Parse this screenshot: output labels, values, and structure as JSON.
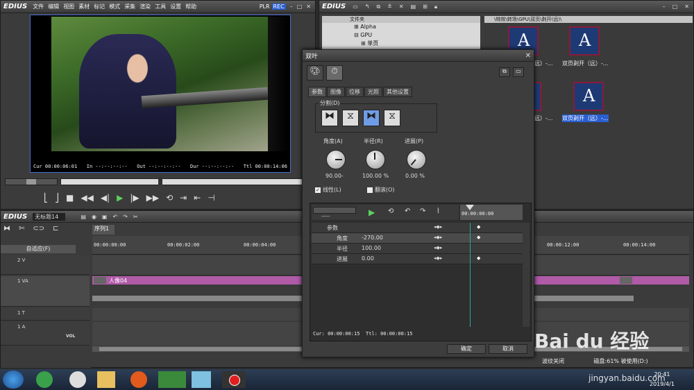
{
  "player": {
    "logo": "EDIUS",
    "menu": [
      "文件",
      "编辑",
      "视图",
      "素材",
      "标记",
      "模式",
      "采集",
      "渲染",
      "工具",
      "设置",
      "帮助"
    ],
    "plr": "PLR",
    "rec": "REC",
    "cur": "Cur 00:00:06:01",
    "in": "In --:--:--:--",
    "out": "Out --:--:--:--",
    "dur": "Dur --:--:--:--",
    "ttl": "Ttl 00:00:14:06"
  },
  "bin": {
    "logo": "EDIUS",
    "folder_header": "文件夹",
    "path": "\\特效\\转场\\GPU\\双页\\剥开(远)\\",
    "tree": [
      "Alpha",
      "GPU",
      "单页"
    ],
    "items": [
      "双页剥开（远）-...",
      "双页剥开（远）-...",
      "双页剥开（远）-...",
      "双页剥开（远）-...",
      "双页剥开（远）-..."
    ]
  },
  "timeline": {
    "logo": "EDIUS",
    "project": "无标题14",
    "sequence_tab": "序列1",
    "adapt_label": "自适应(F)",
    "tracks": [
      "2 V",
      "1 VA",
      "1 T",
      "1 A"
    ],
    "vol": "VOL",
    "clip_label": "人像04",
    "ruler": [
      "00:00:00:00",
      "00:00:02:00",
      "00:00:04:00",
      "00:00:12:00",
      "00:00:14:00"
    ]
  },
  "dialog": {
    "title": "双叶",
    "tabs": [
      "参数",
      "图像",
      "位移",
      "光照",
      "其他设置"
    ],
    "group": "分割(D)",
    "knobs": [
      {
        "label": "角度(A)",
        "value": "90.00-"
      },
      {
        "label": "半径(R)",
        "value": "100.00 %"
      },
      {
        "label": "进展(P)",
        "value": "0.00 %"
      }
    ],
    "linear": "线性(L)",
    "reverse": "翻滚(O)",
    "kf_header": "-----",
    "kf_ruler": "00:00:00:00",
    "params": [
      {
        "name": "参数",
        "value": ""
      },
      {
        "name": "角度",
        "value": "-270.00"
      },
      {
        "name": "半径",
        "value": "100.00"
      },
      {
        "name": "进展",
        "value": "0.00"
      }
    ],
    "cur": "Cur: 00:00:00:15",
    "ttl": "Ttl: 00:00:00:15",
    "ok": "确定",
    "cancel": "取消"
  },
  "status": {
    "wave": "波纹关闭",
    "disk": "磁盘:61% 被使用(D:)"
  },
  "taskbar": {
    "time": "20:41",
    "date": "2019/4/1"
  },
  "watermark": {
    "brand": "Bai du 经验",
    "url": "jingyan.baidu.com"
  }
}
